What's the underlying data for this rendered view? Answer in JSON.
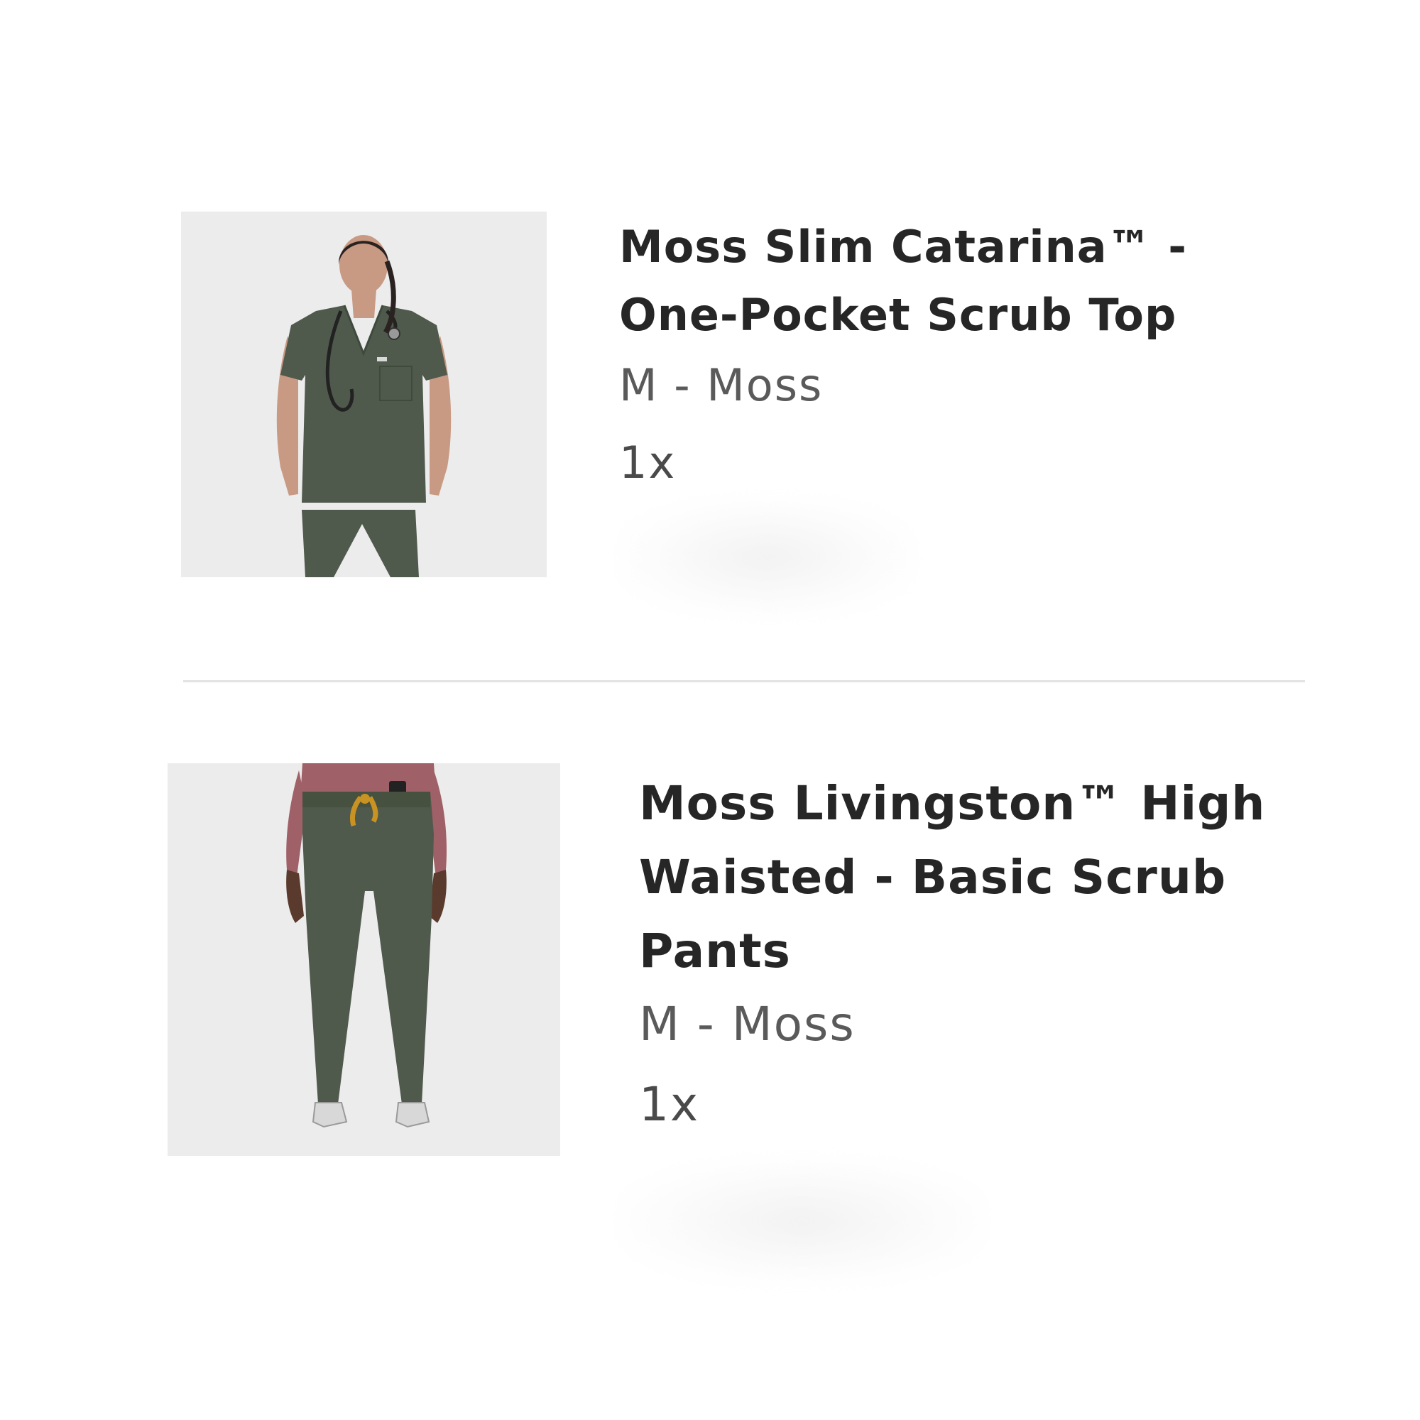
{
  "order_items": [
    {
      "name_line_1": "Moss Slim Catarina™ -",
      "name_line_2": "One-Pocket Scrub Top",
      "variant": "M - Moss",
      "quantity": "1x",
      "image_icon": "scrub-top-photo-icon"
    },
    {
      "name_line_1": "Moss Livingston™ High",
      "name_line_2": "Waisted - Basic Scrub",
      "name_line_3": "Pants",
      "variant": "M - Moss",
      "quantity": "1x",
      "image_icon": "scrub-pants-photo-icon"
    }
  ],
  "colors": {
    "moss": "#4f5a4c",
    "background": "#ffffff",
    "photo_background": "#ececec",
    "divider": "#e3e3e3",
    "drawstring": "#c99323",
    "heather_top": "#a06068"
  }
}
